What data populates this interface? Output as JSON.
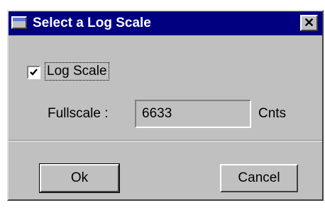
{
  "window": {
    "title": "Select a Log Scale",
    "close_glyph": "✕",
    "title_icon": "window-icon",
    "titlebar_color": "#000080",
    "body_color": "#c0c0c0"
  },
  "log_scale": {
    "label": "Log Scale",
    "checked": true
  },
  "fullscale": {
    "label": "Fullscale :",
    "value": "6633",
    "unit": "Cnts"
  },
  "buttons": {
    "ok_label": "Ok",
    "cancel_label": "Cancel"
  }
}
